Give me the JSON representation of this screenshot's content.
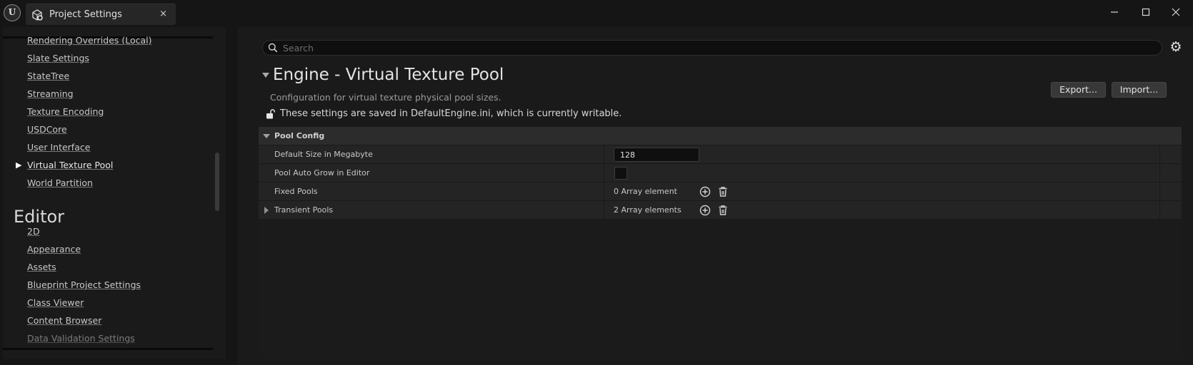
{
  "window": {
    "tab_title": "Project Settings",
    "tab_close": "×",
    "minimize": "—",
    "maximize": "☐",
    "close": "✕"
  },
  "sidebar": {
    "items_top": [
      {
        "label": "Rendering Overrides (Local)"
      },
      {
        "label": "Slate Settings"
      },
      {
        "label": "StateTree"
      },
      {
        "label": "Streaming"
      },
      {
        "label": "Texture Encoding"
      },
      {
        "label": "USDCore"
      },
      {
        "label": "User Interface"
      },
      {
        "label": "Virtual Texture Pool",
        "selected": true
      },
      {
        "label": "World Partition"
      }
    ],
    "section_title": "Editor",
    "items_editor": [
      {
        "label": "2D"
      },
      {
        "label": "Appearance"
      },
      {
        "label": "Assets"
      },
      {
        "label": "Blueprint Project Settings"
      },
      {
        "label": "Class Viewer"
      },
      {
        "label": "Content Browser"
      },
      {
        "label": "Data Validation Settings"
      }
    ],
    "selected_marker": "▶"
  },
  "main": {
    "search_placeholder": "Search",
    "title": "Engine - Virtual Texture Pool",
    "description": "Configuration for virtual texture physical pool sizes.",
    "export_label": "Export...",
    "import_label": "Import...",
    "writable_message": "These settings are saved in DefaultEngine.ini, which is currently writable.",
    "gear_glyph": "⚙"
  },
  "pool_config": {
    "category": "Pool Config",
    "rows": {
      "default_size": {
        "label": "Default Size in Megabyte",
        "value": "128"
      },
      "auto_grow": {
        "label": "Pool Auto Grow in Editor",
        "checked": false
      },
      "fixed_pools": {
        "label": "Fixed Pools",
        "count": "0 Array element"
      },
      "transient_pools": {
        "label": "Transient Pools",
        "count": "2 Array elements"
      }
    }
  },
  "colors": {
    "background": "#151515",
    "panel": "#1a1a1a",
    "row": "#242424",
    "category_header": "#2c2c2c",
    "text": "#c8c8c8"
  }
}
